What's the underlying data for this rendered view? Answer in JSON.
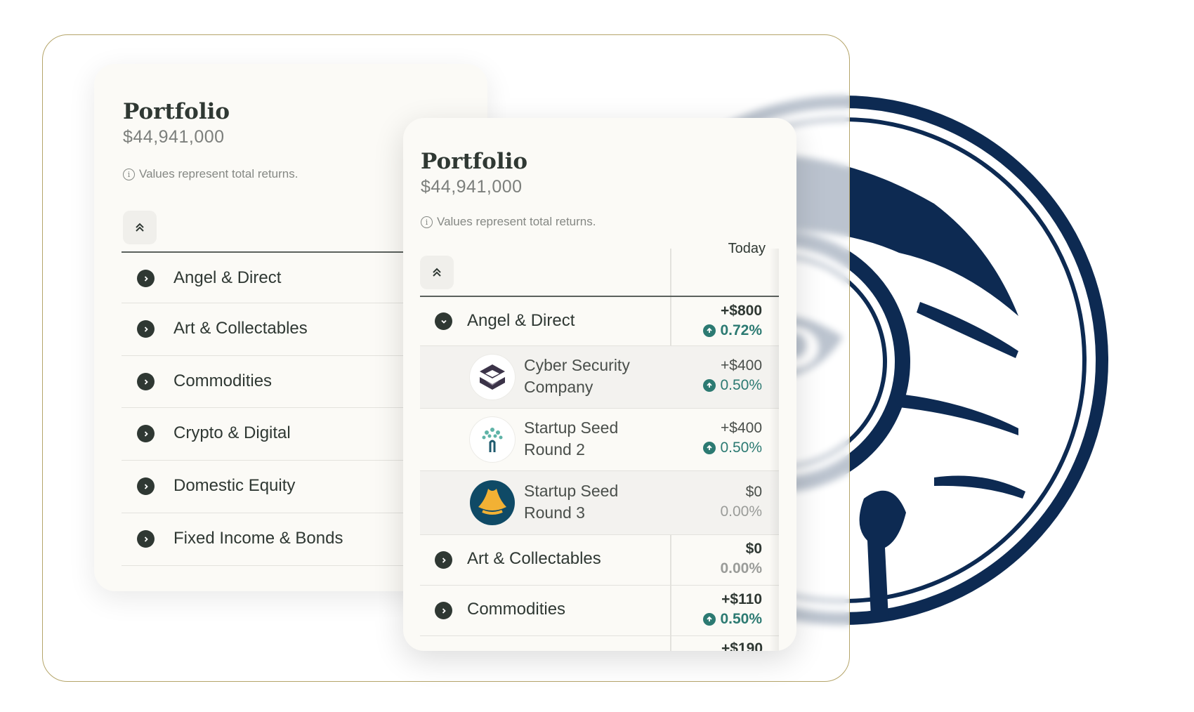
{
  "colors": {
    "frame_border": "#b5a56a",
    "emblem_navy": "#0d2a52",
    "positive": "#2c7a72",
    "text": "#2f3833"
  },
  "back_card": {
    "title": "Portfolio",
    "total": "$44,941,000",
    "info_text": "Values represent total returns.",
    "categories": [
      {
        "label": "Angel & Direct",
        "icon": "chevron-right-icon"
      },
      {
        "label": "Art & Collectables",
        "icon": "chevron-right-icon"
      },
      {
        "label": "Commodities",
        "icon": "chevron-right-icon"
      },
      {
        "label": "Crypto & Digital",
        "icon": "chevron-right-icon"
      },
      {
        "label": "Domestic Equity",
        "icon": "chevron-right-icon"
      },
      {
        "label": "Fixed Income & Bonds",
        "icon": "chevron-right-icon"
      }
    ]
  },
  "front_card": {
    "title": "Portfolio",
    "total": "$44,941,000",
    "info_text": "Values represent total returns.",
    "column_header": "Today",
    "angel": {
      "label": "Angel & Direct",
      "value": "+$800",
      "pct": "0.72%",
      "expanded": true
    },
    "holdings": [
      {
        "label": "Cyber Security Company",
        "value": "+$400",
        "pct": "0.50%",
        "logo": "cube-logo-icon"
      },
      {
        "label": "Startup Seed Round 2",
        "value": "+$400",
        "pct": "0.50%",
        "logo": "tree-logo-icon"
      },
      {
        "label": "Startup Seed Round 3",
        "value": "$0",
        "pct": "0.00%",
        "logo": "triangle-badge-logo-icon"
      }
    ],
    "art": {
      "label": "Art & Collectables",
      "value": "$0",
      "pct": "0.00%"
    },
    "commodities": {
      "label": "Commodities",
      "value": "+$110",
      "pct": "0.50%"
    },
    "partial_value": "+$190"
  }
}
